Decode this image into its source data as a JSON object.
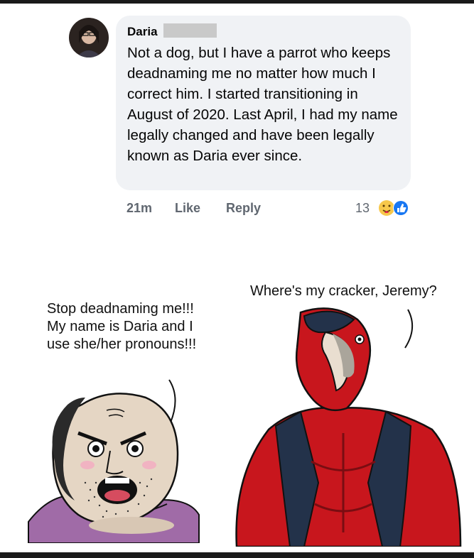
{
  "post": {
    "author": "Daria",
    "text": "Not a dog, but I have a parrot who keeps deadnaming me no matter how much I correct him. I started transitioning in August of 2020. Last April, I had my name legally changed and have been legally known as Daria ever since.",
    "time": "21m",
    "like_label": "Like",
    "reply_label": "Reply",
    "reaction_count": "13",
    "reactions": [
      "hug-reaction-icon",
      "like-reaction-icon"
    ]
  },
  "comic": {
    "left_speech": "Stop deadnaming me!!! My name is Daria and I use she/her pronouns!!!",
    "right_speech": "Where's my cracker, Jeremy?"
  },
  "colors": {
    "bubble": "#f0f2f5",
    "like_blue": "#1877f2",
    "parrot_red": "#c8161d",
    "skin": "#e5d6c4"
  }
}
